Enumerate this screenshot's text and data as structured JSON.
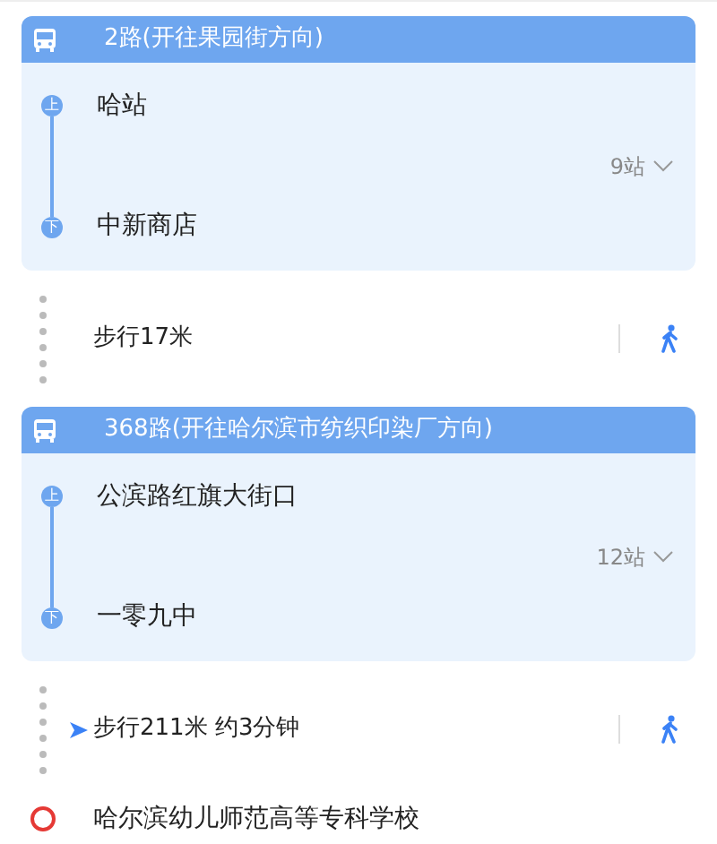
{
  "segments": [
    {
      "kind": "bus",
      "line": "2路",
      "direction": "(开往果园街方向)",
      "board_badge": "上",
      "board": "哈站",
      "stops": "9站",
      "alight_badge": "下",
      "alight": "中新商店"
    },
    {
      "kind": "walk",
      "text": "步行17米",
      "current": false
    },
    {
      "kind": "bus",
      "line": "368路",
      "direction": "(开往哈尔滨市纺织印染厂方向)",
      "board_badge": "上",
      "board": "公滨路红旗大街口",
      "stops": "12站",
      "alight_badge": "下",
      "alight": "一零九中"
    },
    {
      "kind": "walk",
      "text": "步行211米 约3分钟",
      "current": true
    },
    {
      "kind": "destination",
      "name": "哈尔滨幼儿师范高等专科学校"
    }
  ]
}
